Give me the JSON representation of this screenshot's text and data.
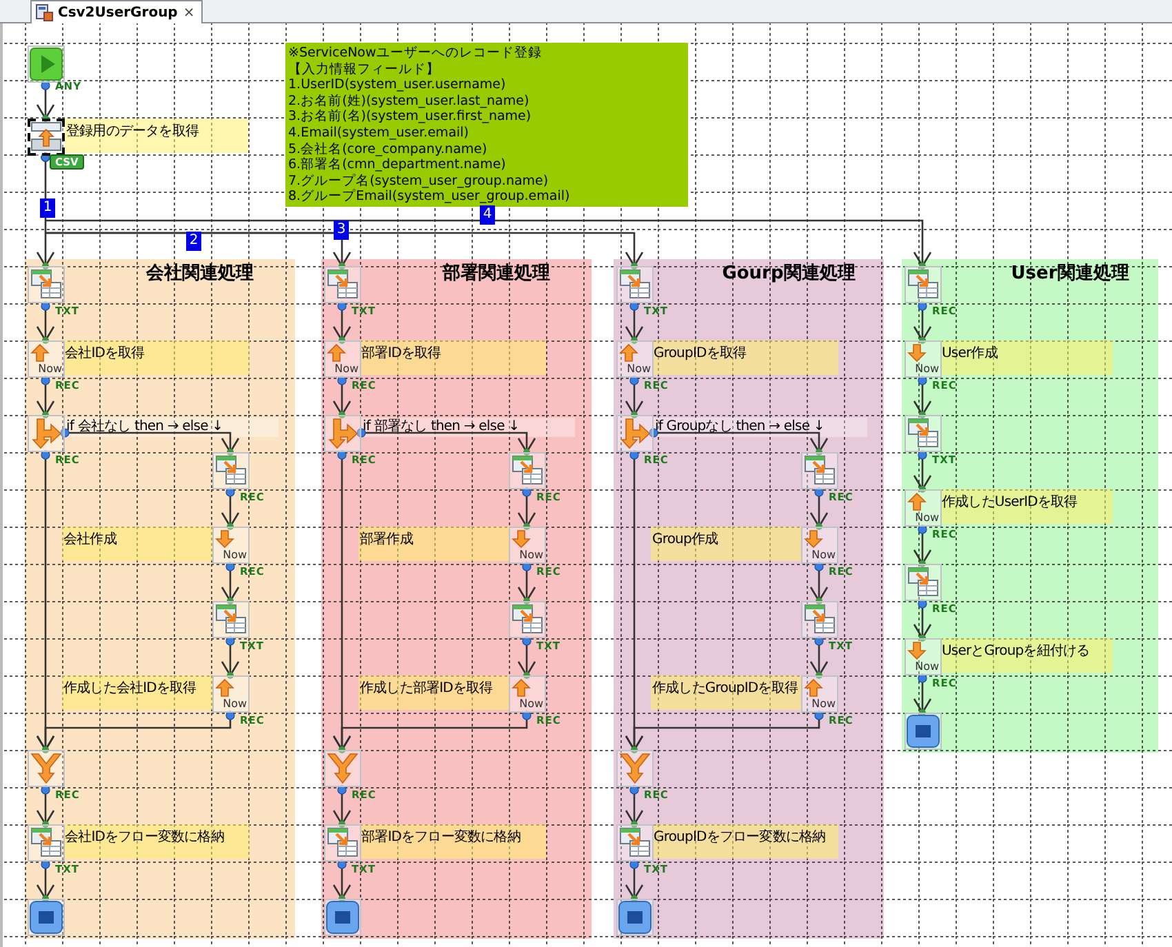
{
  "tab": {
    "title": "Csv2UserGroup",
    "close": "×"
  },
  "start": {
    "port": "ANY"
  },
  "source": {
    "note": "登録用のデータを取得",
    "port": "CSV",
    "selected": true
  },
  "memo": {
    "lines": [
      "※ServiceNowユーザーへのレコード登録",
      "【入力情報フィールド】",
      "1.UserID(system_user.username)",
      "2.お名前(姓)(system_user.last_name)",
      "3.お名前(名)(system_user.first_name)",
      "4.Email(system_user.email)",
      "5.会社名(core_company.name)",
      "6.部署名(cmn_department.name)",
      "7.グループ名(system_user_group.name)",
      "8.グループEmail(system_user_group.email)"
    ]
  },
  "connectors": [
    {
      "number": "1"
    },
    {
      "number": "2"
    },
    {
      "number": "3"
    },
    {
      "number": "4"
    }
  ],
  "lanes": [
    {
      "title": "会社関連処理",
      "color": "#fbe3c4",
      "steps": [
        {
          "kind": "table",
          "port": "TXT"
        },
        {
          "kind": "get",
          "sub": "Now",
          "note": "会社IDを取得",
          "port": "REC"
        },
        {
          "kind": "branch",
          "note": "if 会社なし then → else ↓",
          "port": "REC",
          "children": [
            {
              "kind": "table",
              "port": "REC"
            },
            {
              "kind": "put",
              "sub": "Now",
              "note": "会社作成",
              "port": "REC"
            },
            {
              "kind": "table",
              "port": "TXT"
            },
            {
              "kind": "get",
              "sub": "Now",
              "note": "作成した会社IDを取得",
              "port": "REC"
            }
          ]
        },
        {
          "kind": "merge",
          "port": "REC"
        },
        {
          "kind": "table",
          "note": "会社IDをフロー変数に格納",
          "port": "TXT"
        },
        {
          "kind": "end"
        }
      ]
    },
    {
      "title": "部署関連処理",
      "color": "#f8c0c0",
      "steps": [
        {
          "kind": "table",
          "port": "TXT"
        },
        {
          "kind": "get",
          "sub": "Now",
          "note": "部署IDを取得",
          "port": "REC"
        },
        {
          "kind": "branch",
          "note": "if 部署なし then → else ↓",
          "port": "REC",
          "children": [
            {
              "kind": "table",
              "port": "REC"
            },
            {
              "kind": "put",
              "sub": "Now",
              "note": "部署作成",
              "port": "REC"
            },
            {
              "kind": "table",
              "port": "TXT"
            },
            {
              "kind": "get",
              "sub": "Now",
              "note": "作成した部署IDを取得",
              "port": "REC"
            }
          ]
        },
        {
          "kind": "merge",
          "port": "REC"
        },
        {
          "kind": "table",
          "note": "部署IDをフロー変数に格納",
          "port": "TXT"
        },
        {
          "kind": "end"
        }
      ]
    },
    {
      "title": "Gourp関連処理",
      "color": "#e6cada",
      "steps": [
        {
          "kind": "table",
          "port": "TXT"
        },
        {
          "kind": "get",
          "sub": "Now",
          "note": "GroupIDを取得",
          "port": "REC"
        },
        {
          "kind": "branch",
          "note": "if Groupなし then → else ↓",
          "port": "REC",
          "children": [
            {
              "kind": "table",
              "port": "REC"
            },
            {
              "kind": "put",
              "sub": "Now",
              "note": "Group作成",
              "port": "REC"
            },
            {
              "kind": "table",
              "port": "TXT"
            },
            {
              "kind": "get",
              "sub": "Now",
              "note": "作成したGroupIDを取得",
              "port": "REC"
            }
          ]
        },
        {
          "kind": "merge",
          "port": "REC"
        },
        {
          "kind": "table",
          "note": "GroupIDをフロー変数に格納",
          "port": "TXT"
        },
        {
          "kind": "end"
        }
      ]
    },
    {
      "title": "User関連処理",
      "color": "#c4f8c4",
      "steps": [
        {
          "kind": "table",
          "port": "REC"
        },
        {
          "kind": "put",
          "sub": "Now",
          "note": "User作成",
          "port": "REC"
        },
        {
          "kind": "table",
          "port": "TXT"
        },
        {
          "kind": "get",
          "sub": "Now",
          "note": "作成したUserIDを取得",
          "port": "REC"
        },
        {
          "kind": "table",
          "port": "REC"
        },
        {
          "kind": "put",
          "sub": "Now",
          "note": "UserとGroupを紐付ける",
          "port": "REC"
        },
        {
          "kind": "end"
        }
      ]
    }
  ]
}
